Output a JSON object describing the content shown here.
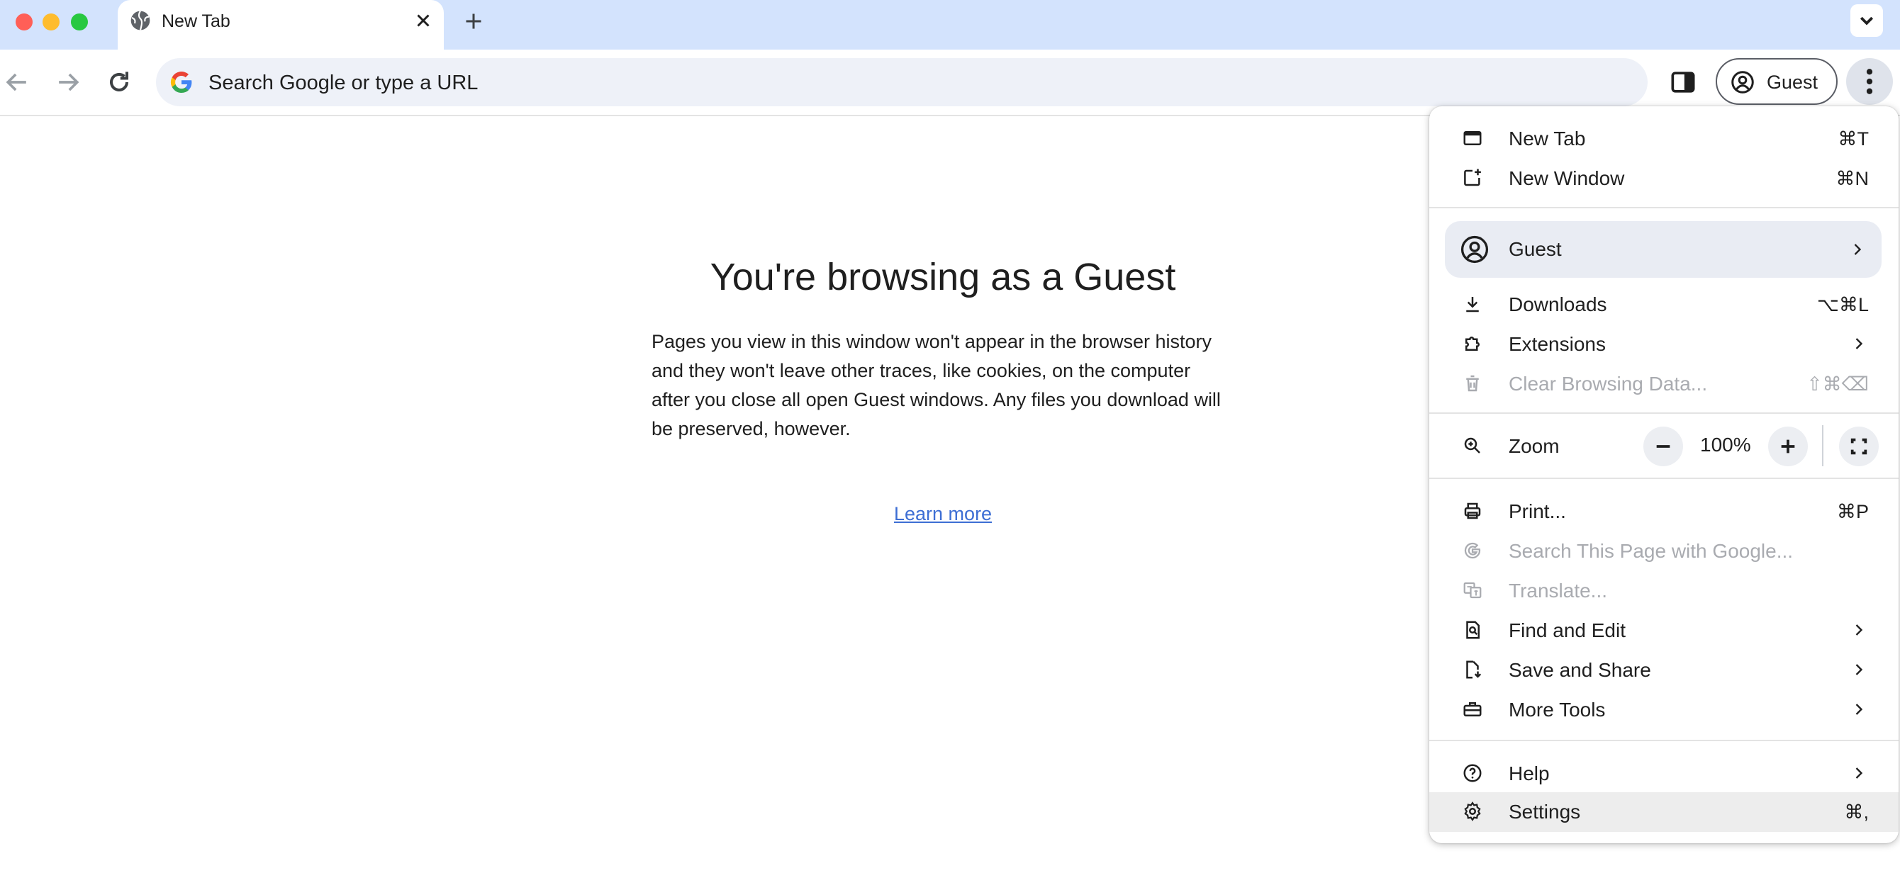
{
  "window": {
    "traffic_colors": {
      "close": "#ff5f57",
      "minimize": "#febc2e",
      "maximize": "#28c840"
    }
  },
  "tabs": [
    {
      "title": "New Tab",
      "icon": "globe-icon",
      "active": true
    }
  ],
  "toolbar": {
    "omnibox_placeholder": "Search Google or type a URL",
    "profile_label": "Guest"
  },
  "page": {
    "heading": "You're browsing as a Guest",
    "paragraph": "Pages you view in this window won't appear in the browser history and they won't leave other traces, like cookies, on the computer after you close all open Guest windows. Any files you download will be preserved, however.",
    "learn_more": "Learn more",
    "link_color": "#3d6ed4"
  },
  "menu": {
    "items": [
      {
        "label": "New Tab",
        "shortcut": "⌘T",
        "icon": "new-tab-icon"
      },
      {
        "label": "New Window",
        "shortcut": "⌘N",
        "icon": "new-window-icon"
      },
      {
        "label": "Guest",
        "icon": "profile-icon",
        "submenu": true,
        "highlighted": true
      },
      {
        "label": "Downloads",
        "shortcut": "⌥⌘L",
        "icon": "download-icon"
      },
      {
        "label": "Extensions",
        "icon": "extension-icon",
        "submenu": true
      },
      {
        "label": "Clear Browsing Data...",
        "shortcut": "⇧⌘⌫",
        "icon": "trash-icon",
        "disabled": true
      },
      {
        "label": "Zoom",
        "icon": "zoom-icon"
      },
      {
        "label": "Print...",
        "shortcut": "⌘P",
        "icon": "printer-icon"
      },
      {
        "label": "Search This Page with Google...",
        "icon": "google-g-icon",
        "disabled": true
      },
      {
        "label": "Translate...",
        "icon": "translate-icon",
        "disabled": true
      },
      {
        "label": "Find and Edit",
        "icon": "find-page-icon",
        "submenu": true
      },
      {
        "label": "Save and Share",
        "icon": "save-share-icon",
        "submenu": true
      },
      {
        "label": "More Tools",
        "icon": "toolbox-icon",
        "submenu": true
      },
      {
        "label": "Help",
        "icon": "help-icon",
        "submenu": true
      },
      {
        "label": "Settings",
        "shortcut": "⌘,",
        "icon": "gear-icon",
        "hovered": true
      }
    ],
    "zoom": {
      "minus": "−",
      "value": "100%",
      "plus": "+"
    }
  }
}
